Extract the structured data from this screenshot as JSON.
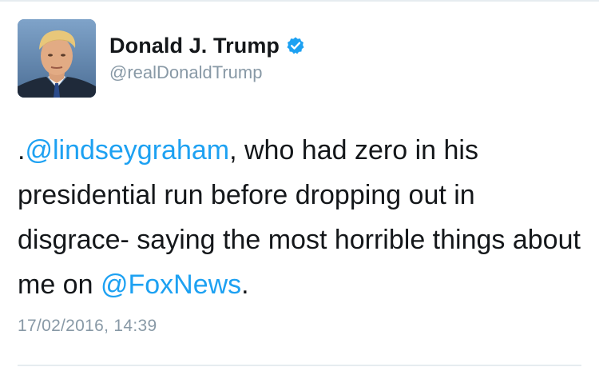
{
  "tweet": {
    "author": {
      "display_name": "Donald J. Trump",
      "handle": "@realDonaldTrump",
      "verified": true,
      "avatar_icon": "profile-photo"
    },
    "text_segments": [
      {
        "type": "text",
        "value": "."
      },
      {
        "type": "mention",
        "value": "@lindseygraham"
      },
      {
        "type": "text",
        "value": ", who had zero in his presidential run before dropping out in disgrace- saying the most horrible things about me on "
      },
      {
        "type": "mention",
        "value": "@FoxNews"
      },
      {
        "type": "text",
        "value": "."
      }
    ],
    "timestamp": "17/02/2016, 14:39"
  },
  "colors": {
    "mention": "#1da1f2",
    "secondary_text": "#8899a6",
    "verified_badge": "#1da1f2",
    "primary_text": "#14171a"
  }
}
